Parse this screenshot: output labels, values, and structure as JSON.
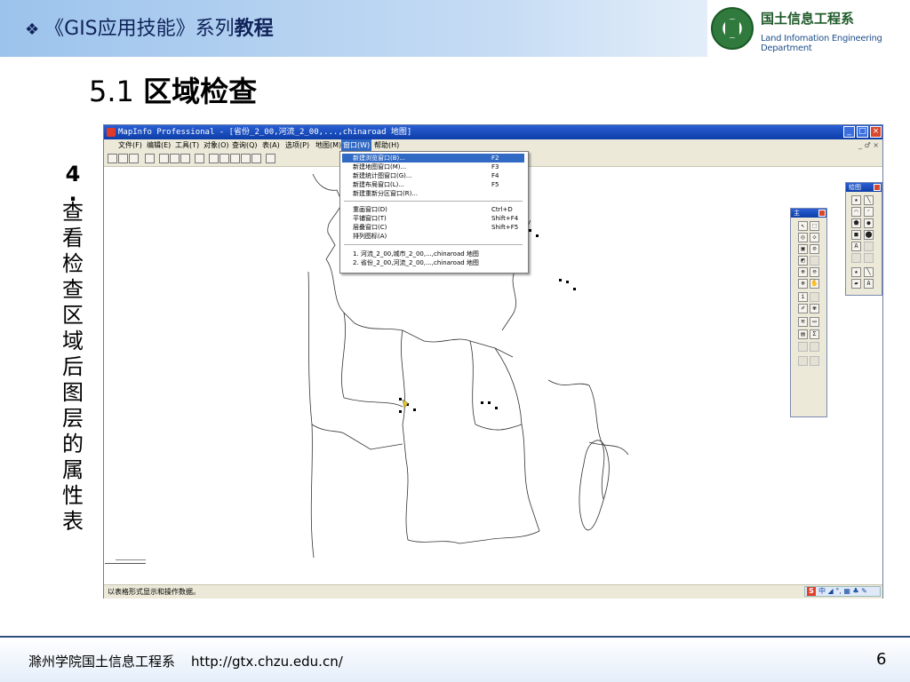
{
  "header": {
    "bullet": "❖",
    "course_prefix": "《GIS应用技能》系列",
    "course_suffix": "教程",
    "logo_title": "国土信息工程系",
    "logo_subtitle": "Land Infomation Engineering Department"
  },
  "section": {
    "number": "5.1 ",
    "title": "区域检查"
  },
  "vertical_caption": [
    "4",
    ".",
    "查",
    "看",
    "检",
    "查",
    "区",
    "域",
    "后",
    "图",
    "层",
    "的",
    "属",
    "性",
    "表"
  ],
  "app": {
    "title": "MapInfo Professional - [省份_2_00,河流_2_00,...,chinaroad 地图]",
    "window_buttons": [
      "_",
      "□",
      "×"
    ],
    "menus": [
      "文件(F)",
      "编辑(E)",
      "工具(T)",
      "对象(O)",
      "查询(Q)",
      "表(A)",
      "选项(P)",
      "地图(M)",
      "窗口(W)",
      "帮助(H)"
    ],
    "active_menu_index": 8,
    "doc_controls": "_ ♂ ×",
    "window_menu": {
      "group1": [
        {
          "label": "新建浏览窗口(B)...",
          "key": "F2",
          "highlighted": true
        },
        {
          "label": "新建地图窗口(M)...",
          "key": "F3"
        },
        {
          "label": "新建统计图窗口(G)...",
          "key": "F4"
        },
        {
          "label": "新建布局窗口(L)...",
          "key": "F5"
        },
        {
          "label": "新建重新分区窗口(R)...",
          "key": ""
        }
      ],
      "group2": [
        {
          "label": "重画窗口(D)",
          "key": "Ctrl+D"
        },
        {
          "label": "平铺窗口(T)",
          "key": "Shift+F4"
        },
        {
          "label": "层叠窗口(C)",
          "key": "Shift+F5"
        },
        {
          "label": "排列图标(A)",
          "key": ""
        }
      ],
      "group3": [
        {
          "label": "1. 河流_2_00,城市_2_00,...,chinaroad 地图",
          "key": ""
        },
        {
          "label": "2. 省份_2_00,河流_2_00,...,chinaroad 地图",
          "key": ""
        }
      ]
    },
    "status_text": "以表格形式显示和操作数据。",
    "tray_text": "中 ◢ °, ▦ ♣ ✎",
    "tray_s": "S",
    "main_palette": {
      "title": "主",
      "rows": 13
    },
    "draw_palette": {
      "title": "绘图",
      "rows": 8
    }
  },
  "footer": {
    "school": "滁州学院国土信息工程系",
    "url": "http://gtx.chzu.edu.cn/",
    "page": "6"
  },
  "colors": {
    "header_navy": "#10235a",
    "menu_highlight": "#316ac5",
    "title_blue": "#0d3ea8",
    "logo_green": "#2f7a3c"
  }
}
